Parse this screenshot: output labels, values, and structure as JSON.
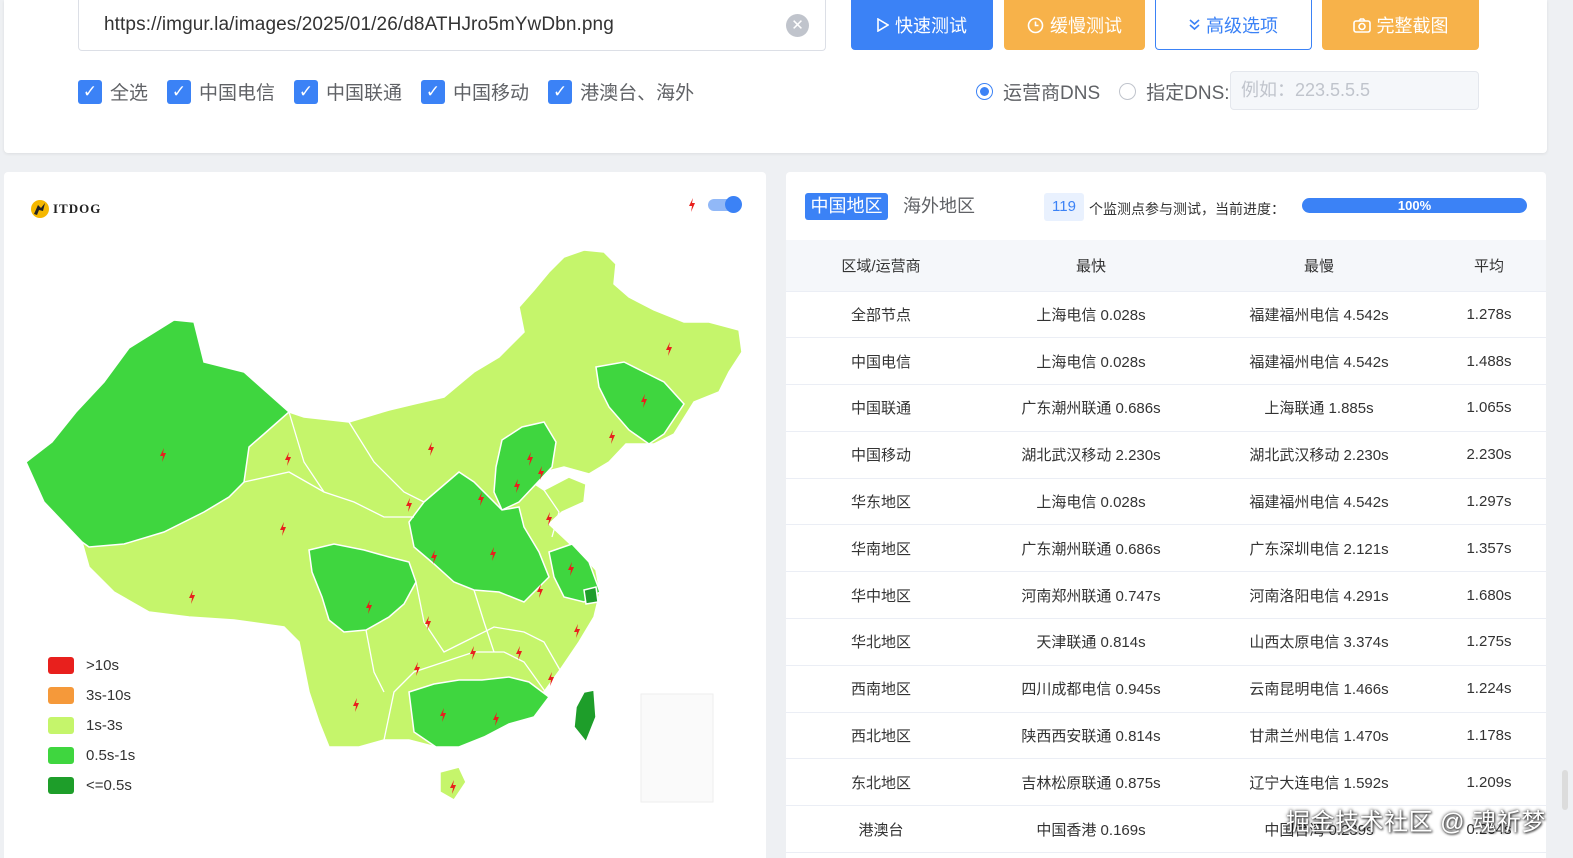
{
  "search": {
    "url": "https://imgur.la/images/2025/01/26/d8ATHJro5mYwDbn.png",
    "clear_icon": "close-circle-icon"
  },
  "buttons": {
    "quick": "快速测试",
    "slow": "缓慢测试",
    "advanced": "高级选项",
    "screenshot": "完整截图"
  },
  "carriers": [
    {
      "label": "全选",
      "checked": true
    },
    {
      "label": "中国电信",
      "checked": true
    },
    {
      "label": "中国联通",
      "checked": true
    },
    {
      "label": "中国移动",
      "checked": true
    },
    {
      "label": "港澳台、海外",
      "checked": true
    }
  ],
  "dns": {
    "option_isp": "运营商DNS",
    "option_custom": "指定DNS:",
    "selected": "运营商DNS",
    "placeholder": "例如：223.5.5.5"
  },
  "map": {
    "logo_text": "ITDOG",
    "legend": [
      {
        "label": ">10s",
        "color": "#e8201d"
      },
      {
        "label": "3s-10s",
        "color": "#f5993a"
      },
      {
        "label": "1s-3s",
        "color": "#c5f56b"
      },
      {
        "label": "0.5s-1s",
        "color": "#3fd63f"
      },
      {
        "label": "<=0.5s",
        "color": "#1e9e2a"
      }
    ]
  },
  "results": {
    "tab_china": "中国地区",
    "tab_overseas": "海外地区",
    "node_count": "119",
    "node_label": "个监测点参与测试，当前进度：",
    "progress_fraction": 1.0,
    "progress_text": "100%",
    "columns": [
      "区域/运营商",
      "最快",
      "最慢",
      "平均"
    ],
    "rows": [
      [
        "全部节点",
        "上海电信 0.028s",
        "福建福州电信 4.542s",
        "1.278s"
      ],
      [
        "中国电信",
        "上海电信 0.028s",
        "福建福州电信 4.542s",
        "1.488s"
      ],
      [
        "中国联通",
        "广东潮州联通 0.686s",
        "上海联通 1.885s",
        "1.065s"
      ],
      [
        "中国移动",
        "湖北武汉移动 2.230s",
        "湖北武汉移动 2.230s",
        "2.230s"
      ],
      [
        "华东地区",
        "上海电信 0.028s",
        "福建福州电信 4.542s",
        "1.297s"
      ],
      [
        "华南地区",
        "广东潮州联通 0.686s",
        "广东深圳电信 2.121s",
        "1.357s"
      ],
      [
        "华中地区",
        "河南郑州联通 0.747s",
        "河南洛阳电信 4.291s",
        "1.680s"
      ],
      [
        "华北地区",
        "天津联通 0.814s",
        "山西太原电信 3.374s",
        "1.275s"
      ],
      [
        "西南地区",
        "四川成都电信 0.945s",
        "云南昆明电信 1.466s",
        "1.224s"
      ],
      [
        "西北地区",
        "陕西西安联通 0.814s",
        "甘肃兰州电信 1.470s",
        "1.178s"
      ],
      [
        "东北地区",
        "吉林松原联通 0.875s",
        "辽宁大连电信 1.592s",
        "1.209s"
      ],
      [
        "港澳台",
        "中国香港 0.169s",
        "中国台湾 0.239s",
        "0.204s"
      ]
    ]
  },
  "watermark": "掘金技术社区 @ 魂祈梦"
}
